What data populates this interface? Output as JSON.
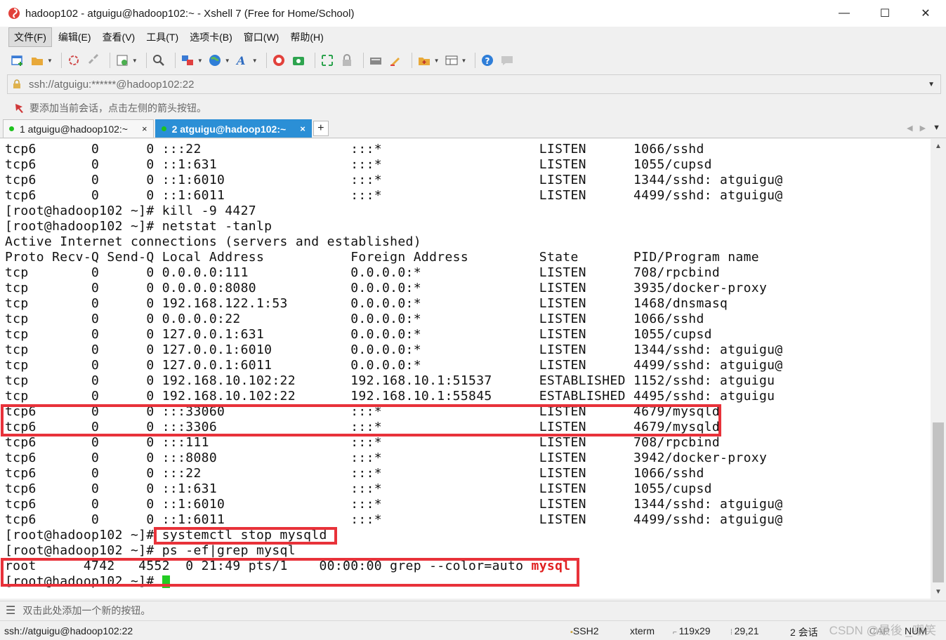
{
  "window": {
    "title": "hadoop102 - atguigu@hadoop102:~ - Xshell 7 (Free for Home/School)",
    "controls": {
      "minimize": "—",
      "maximize": "☐",
      "close": "✕"
    }
  },
  "menu": [
    "文件(F)",
    "编辑(E)",
    "查看(V)",
    "工具(T)",
    "选项卡(B)",
    "窗口(W)",
    "帮助(H)"
  ],
  "address": {
    "url": "ssh://atguigu:******@hadoop102:22"
  },
  "hint": {
    "text": "要添加当前会话，点击左侧的箭头按钮。"
  },
  "tabs": [
    {
      "label": "1 atguigu@hadoop102:~",
      "close": "×"
    },
    {
      "label": "2 atguigu@hadoop102:~",
      "close": "×"
    }
  ],
  "tab_add": "+",
  "terminal": {
    "lines": [
      "tcp6       0      0 :::22                   :::*                    LISTEN      1066/sshd",
      "tcp6       0      0 ::1:631                 :::*                    LISTEN      1055/cupsd",
      "tcp6       0      0 ::1:6010                :::*                    LISTEN      1344/sshd: atguigu@",
      "tcp6       0      0 ::1:6011                :::*                    LISTEN      4499/sshd: atguigu@",
      "[root@hadoop102 ~]# kill -9 4427",
      "[root@hadoop102 ~]# netstat -tanlp",
      "Active Internet connections (servers and established)",
      "Proto Recv-Q Send-Q Local Address           Foreign Address         State       PID/Program name",
      "tcp        0      0 0.0.0.0:111             0.0.0.0:*               LISTEN      708/rpcbind",
      "tcp        0      0 0.0.0.0:8080            0.0.0.0:*               LISTEN      3935/docker-proxy",
      "tcp        0      0 192.168.122.1:53        0.0.0.0:*               LISTEN      1468/dnsmasq",
      "tcp        0      0 0.0.0.0:22              0.0.0.0:*               LISTEN      1066/sshd",
      "tcp        0      0 127.0.0.1:631           0.0.0.0:*               LISTEN      1055/cupsd",
      "tcp        0      0 127.0.0.1:6010          0.0.0.0:*               LISTEN      1344/sshd: atguigu@",
      "tcp        0      0 127.0.0.1:6011          0.0.0.0:*               LISTEN      4499/sshd: atguigu@",
      "tcp        0      0 192.168.10.102:22       192.168.10.1:51537      ESTABLISHED 1152/sshd: atguigu",
      "tcp        0      0 192.168.10.102:22       192.168.10.1:55845      ESTABLISHED 4495/sshd: atguigu",
      "tcp6       0      0 :::33060                :::*                    LISTEN      4679/mysqld",
      "tcp6       0      0 :::3306                 :::*                    LISTEN      4679/mysqld",
      "tcp6       0      0 :::111                  :::*                    LISTEN      708/rpcbind",
      "tcp6       0      0 :::8080                 :::*                    LISTEN      3942/docker-proxy",
      "tcp6       0      0 :::22                   :::*                    LISTEN      1066/sshd",
      "tcp6       0      0 ::1:631                 :::*                    LISTEN      1055/cupsd",
      "tcp6       0      0 ::1:6010                :::*                    LISTEN      1344/sshd: atguigu@",
      "tcp6       0      0 ::1:6011                :::*                    LISTEN      4499/sshd: atguigu@",
      "[root@hadoop102 ~]# systemctl stop mysqld",
      "[root@hadoop102 ~]# ps -ef|grep mysql"
    ],
    "grep_line": {
      "prefix": "root      4742   4552  0 21:49 pts/1    00:00:00 grep --color=auto ",
      "match": "mysql"
    },
    "prompt": "[root@hadoop102 ~]# "
  },
  "quickbar": {
    "text": "双击此处添加一个新的按钮。"
  },
  "status": {
    "session": "ssh://atguigu@hadoop102:22",
    "protocol": "SSH2",
    "term": "xterm",
    "size": "119x29",
    "position": "29,21",
    "sessions": "2 会话",
    "cap": "CAP",
    "num": "NUM",
    "watermark": "CSDN @最後 _嘲笑"
  },
  "colors": {
    "active_tab": "#2b8fd6",
    "highlight_box": "#e8323a",
    "grep_match": "#e02020",
    "cursor": "#22cc22"
  }
}
